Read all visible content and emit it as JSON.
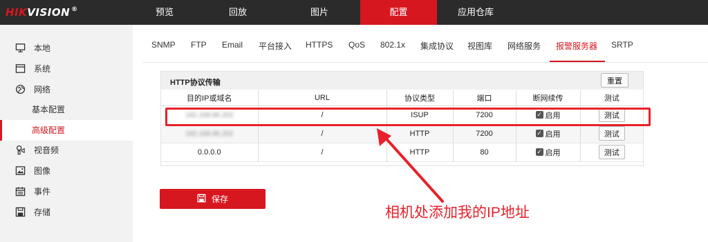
{
  "brand": {
    "hik": "HIK",
    "vision": "VISION",
    "reg": "®"
  },
  "topnav": {
    "preview": "预览",
    "playback": "回放",
    "picture": "图片",
    "config": "配置",
    "app_store": "应用仓库"
  },
  "sidebar": {
    "local": "本地",
    "system": "系统",
    "network": "网络",
    "basic_config": "基本配置",
    "advanced_config": "高级配置",
    "video_audio": "视音频",
    "image": "图像",
    "event": "事件",
    "storage": "存储"
  },
  "tabs": {
    "snmp": "SNMP",
    "ftp": "FTP",
    "email": "Email",
    "platform": "平台接入",
    "https": "HTTPS",
    "qos": "QoS",
    "dot1x": "802.1x",
    "integration": "集成协议",
    "view_lib": "视图库",
    "net_service": "网络服务",
    "alarm_server": "报警服务器",
    "srtp": "SRTP"
  },
  "panel": {
    "title": "HTTP协议传输",
    "reset_label": "重置"
  },
  "table": {
    "headers": {
      "dest": "目的IP或域名",
      "url": "URL",
      "protocol": "协议类型",
      "port": "端口",
      "resume": "断网续传",
      "test": "测试"
    },
    "rows": [
      {
        "dest": "192.168.96.202",
        "url": "/",
        "protocol": "ISUP",
        "port": "7200",
        "resume": "启用",
        "test": "测试"
      },
      {
        "dest": "192.168.96.202",
        "url": "/",
        "protocol": "HTTP",
        "port": "7200",
        "resume": "启用",
        "test": "测试"
      },
      {
        "dest": "0.0.0.0",
        "url": "/",
        "protocol": "HTTP",
        "port": "80",
        "resume": "启用",
        "test": "测试"
      }
    ]
  },
  "save_label": "保存",
  "annotation": {
    "text": "相机处添加我的IP地址"
  },
  "colors": {
    "accent": "#d7171f",
    "topbar": "#2b2b2b",
    "annotation": "#e8202a"
  }
}
